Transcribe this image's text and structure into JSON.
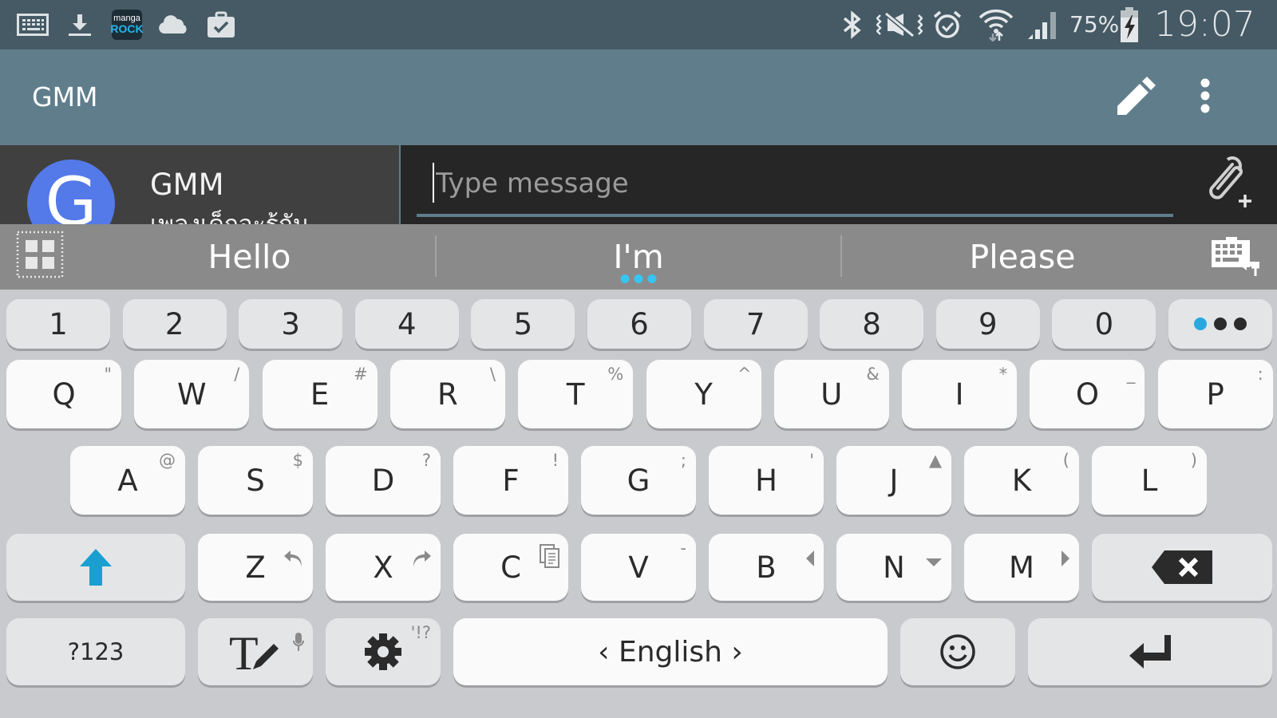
{
  "status_bar": {
    "left_icons": [
      "keyboard-icon",
      "download-icon",
      "manga-rock-app-icon",
      "cloud-icon",
      "briefcase-check-icon"
    ],
    "manga_rock_label_top": "manga",
    "manga_rock_label_bottom": "ROCK",
    "right_icons": [
      "bluetooth-icon",
      "vibrate-mute-icon",
      "alarm-icon",
      "wifi-icon",
      "signal-icon",
      "battery-charging-icon"
    ],
    "battery_percent": "75%",
    "time": "19:07"
  },
  "app_bar": {
    "title": "GMM",
    "actions": [
      "edit-icon",
      "more-vert-icon"
    ]
  },
  "conversation": {
    "avatar_letter": "G",
    "name": "GMM",
    "subtitle": "เพลงเด็กจะรู้กัน",
    "message_placeholder": "Type message",
    "message_value": ""
  },
  "suggestions": {
    "items": [
      "Hello",
      "I'm",
      "Please"
    ],
    "highlighted_index": 1
  },
  "keyboard": {
    "number_row": [
      "1",
      "2",
      "3",
      "4",
      "5",
      "6",
      "7",
      "8",
      "9",
      "0"
    ],
    "row1": [
      {
        "key": "Q",
        "sec": "\""
      },
      {
        "key": "W",
        "sec": "/"
      },
      {
        "key": "E",
        "sec": "#"
      },
      {
        "key": "R",
        "sec": "\\"
      },
      {
        "key": "T",
        "sec": "%"
      },
      {
        "key": "Y",
        "sec": "^"
      },
      {
        "key": "U",
        "sec": "&"
      },
      {
        "key": "I",
        "sec": "*"
      },
      {
        "key": "O",
        "sec": "_"
      },
      {
        "key": "P",
        "sec": ":"
      }
    ],
    "row2": [
      {
        "key": "A",
        "sec": "@"
      },
      {
        "key": "S",
        "sec": "$"
      },
      {
        "key": "D",
        "sec": "?"
      },
      {
        "key": "F",
        "sec": "!"
      },
      {
        "key": "G",
        "sec": ";"
      },
      {
        "key": "H",
        "sec": "'"
      },
      {
        "key": "J",
        "sec": "▲"
      },
      {
        "key": "K",
        "sec": "("
      },
      {
        "key": "L",
        "sec": ")"
      }
    ],
    "row3": [
      {
        "key": "Z",
        "sec_icon": "undo-icon"
      },
      {
        "key": "X",
        "sec_icon": "redo-icon"
      },
      {
        "key": "C",
        "sec_icon": "clipboard-icon"
      },
      {
        "key": "V",
        "sec": "-"
      },
      {
        "key": "B",
        "sec_icon": "cursor-left-icon"
      },
      {
        "key": "N",
        "sec_icon": "cursor-down-icon"
      },
      {
        "key": "M",
        "sec_icon": "cursor-right-icon"
      }
    ],
    "symbols_label": "?123",
    "settings_sec": "'!?",
    "space_label": "‹ English ›",
    "accent_color": "#1a9fd1"
  }
}
